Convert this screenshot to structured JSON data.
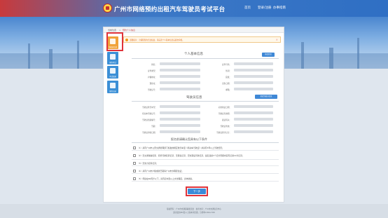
{
  "header": {
    "site_title": "广州市网络预约出租汽车驾驶员考试平台",
    "nav": [
      "首页",
      "登录/注册",
      "办事指南"
    ]
  },
  "breadcrumb": [
    "当前位置",
    "预约个人信息"
  ],
  "sidebar": {
    "items": [
      {
        "label": "驾驶员信息",
        "icon": "user-card-icon"
      },
      {
        "label": "预约考试",
        "icon": "edit-icon"
      },
      {
        "label": "考试结果",
        "icon": "result-icon"
      },
      {
        "label": "预约记录",
        "icon": "record-icon"
      }
    ]
  },
  "notice": {
    "text": "温馨提示：为保障您的合法权益，请完善个人基本信息后提交审核。",
    "close": "×"
  },
  "personal": {
    "title": "个人基本信息",
    "edit_button": "修改信息",
    "fields": [
      [
        "姓名：",
        "证件号码："
      ],
      [
        "证件类型：",
        "性别："
      ],
      [
        "户籍地址：",
        "民族："
      ],
      [
        "现住址：",
        "出生日期："
      ],
      [
        "驾驶证号：",
        "邮箱："
      ]
    ]
  },
  "license": {
    "title": "驾驶员信息",
    "edit_button": "修改驾驶员信息",
    "fields": [
      [
        "驾驶证准驾车型：",
        "初次领证日期："
      ],
      [
        "机动车驾驶证号：",
        "驾驶证有效期："
      ],
      [
        "驾驶证档案编号：",
        "发证机关："
      ],
      [
        "驾龄：",
        "驾驶证状态："
      ],
      [
        "驾驶证审验日期：",
        "驾驶证累计记分："
      ]
    ]
  },
  "conditions": {
    "title": "报名前请确认您具有以下条件",
    "items": [
      "（1）具有广州市公安交通管理部门核发的相应准驾车型《机动车驾驶证》并具有3年以上驾驶经历；",
      "（2）无交通肇事犯罪、危险驾驶犯罪记录，无吸毒记录，无饮酒后驾驶记录，最近连续3个记分周期内没有记满12分记录；",
      "（3）无暴力犯罪记录；",
      "（4）具有广州市户籍或者已取得广州市办理居住证；",
      "（5）年龄在60周岁以下，具有初中及以上文化程度，身体健康。"
    ]
  },
  "next_button": "下一步",
  "footer": {
    "line1": "版权所有：广州市交通运输委员会　技术支持：广州市交通信息中心",
    "line2": "建议使用IE9及以上版本浏览器，分辨率1366×768"
  }
}
